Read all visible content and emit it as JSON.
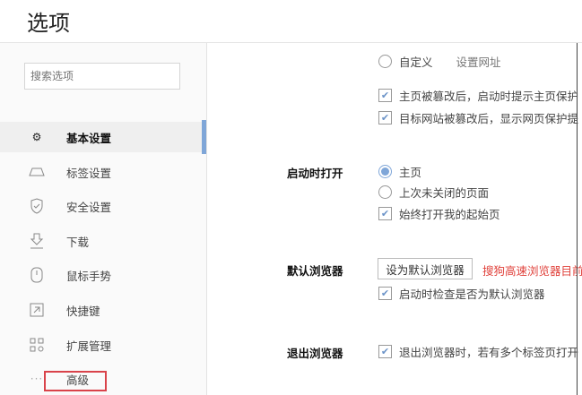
{
  "header": {
    "title": "选项"
  },
  "sidebar": {
    "search_placeholder": "搜索选项",
    "items": [
      {
        "label": "基本设置",
        "icon": "gear-icon",
        "active": true
      },
      {
        "label": "标签设置",
        "icon": "tab-icon"
      },
      {
        "label": "安全设置",
        "icon": "shield-check-icon"
      },
      {
        "label": "下载",
        "icon": "download-icon"
      },
      {
        "label": "鼠标手势",
        "icon": "mouse-icon"
      },
      {
        "label": "快捷键",
        "icon": "shortcut-icon"
      },
      {
        "label": "扩展管理",
        "icon": "extensions-icon"
      },
      {
        "label": "高级",
        "icon": "more-icon"
      }
    ]
  },
  "main": {
    "homepage": {
      "custom_label": "自定义",
      "set_url_link": "设置网址",
      "check1": "主页被篡改后，启动时提示主页保护",
      "check2": "目标网站被篡改后，显示网页保护提"
    },
    "startup": {
      "label": "启动时打开",
      "opt_home": "主页",
      "opt_last": "上次未关闭的页面",
      "opt_always": "始终打开我的起始页"
    },
    "default_browser": {
      "label": "默认浏览器",
      "button": "设为默认浏览器",
      "warning": "搜狗高速浏览器目前",
      "check": "启动时检查是否为默认浏览器"
    },
    "exit": {
      "label": "退出浏览器",
      "check": "退出浏览器时，若有多个标签页打开"
    }
  }
}
